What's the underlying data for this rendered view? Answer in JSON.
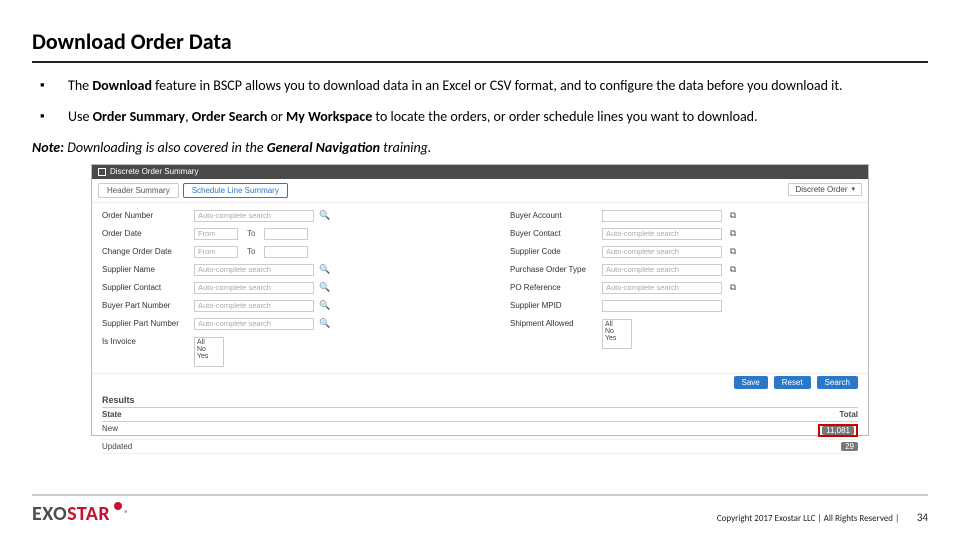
{
  "title": "Download Order Data",
  "bullets": {
    "b1_pre": "The ",
    "b1_bold": "Download ",
    "b1_post": "feature in BSCP allows you to download data in an Excel or CSV format, and to configure the data before you download it.",
    "b2_pre": "Use ",
    "b2_bold1": "Order Summary",
    "b2_mid1": ", ",
    "b2_bold2": "Order Search ",
    "b2_mid2": "or ",
    "b2_bold3": "My Workspace ",
    "b2_post": "to locate the orders, or order schedule lines you want to download."
  },
  "note": {
    "label": "Note: ",
    "text_pre": "Downloading is also covered in the ",
    "text_bold": "General Navigation ",
    "text_post": "training."
  },
  "shot": {
    "topbar": "Discrete Order Summary",
    "tab1": "Header Summary",
    "tab2": "Schedule Line Summary",
    "download_btn": "Discrete Order",
    "placeholders": {
      "auto": "Auto-complete search",
      "from": "From",
      "to": "To"
    },
    "left_fields": {
      "order_number": "Order Number",
      "order_date": "Order Date",
      "change_order_date": "Change Order Date",
      "supplier_name": "Supplier Name",
      "supplier_contact": "Supplier Contact",
      "buyer_part_number": "Buyer Part Number",
      "supplier_part_number": "Supplier Part Number",
      "is_invoice": "Is Invoice"
    },
    "right_fields": {
      "buyer_account": "Buyer Account",
      "buyer_contact": "Buyer Contact",
      "supplier_code": "Supplier Code",
      "purchase_order_type": "Purchase Order Type",
      "po_reference": "PO Reference",
      "supplier_mpid": "Supplier MPID",
      "shipment_allowed": "Shipment Allowed"
    },
    "list_options": {
      "all": "All",
      "no": "No",
      "yes": "Yes"
    },
    "buttons": {
      "save": "Save",
      "reset": "Reset",
      "search": "Search"
    },
    "results": {
      "heading": "Results",
      "col_state": "State",
      "col_total": "Total",
      "rows": [
        {
          "state": "New",
          "total": "11,081"
        },
        {
          "state": "Updated",
          "total": "29"
        }
      ]
    }
  },
  "footer": {
    "logo_exo": "EXO",
    "logo_star": "STAR",
    "copyright": "Copyright 2017 Exostar LLC | All Rights Reserved |",
    "page": "34"
  }
}
